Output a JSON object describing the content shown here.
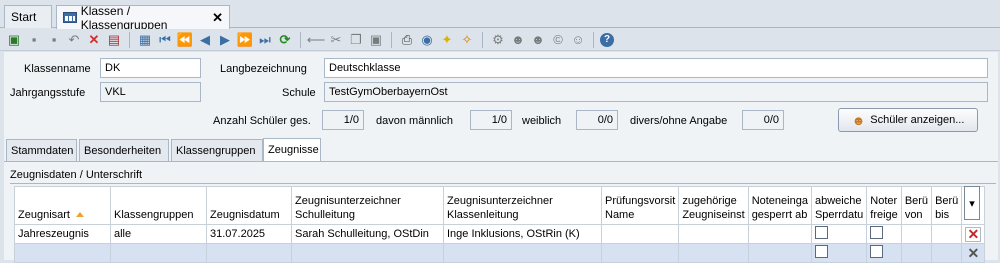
{
  "tabs": [
    {
      "label": "Start"
    },
    {
      "label": "Klassen / Klassengruppen"
    }
  ],
  "toolbar": {
    "icons": [
      "new-icon",
      "save-icon",
      "save-disabled-icon",
      "undo-icon",
      "delete-icon",
      "delete-record-icon",
      "list-icon",
      "first-icon",
      "prev-page-icon",
      "prev-icon",
      "next-icon",
      "next-page-icon",
      "last-icon",
      "refresh-icon",
      "back-arrow-icon",
      "cut-icon",
      "copy-icon",
      "paste-icon",
      "print-icon",
      "preview-icon",
      "bulb-icon",
      "wizard-icon",
      "settings-icon",
      "users-icon",
      "users2-icon",
      "copyright-icon",
      "user-settings-icon",
      "help-icon"
    ]
  },
  "form": {
    "klassenname_label": "Klassenname",
    "klassenname_value": "DK",
    "langbez_label": "Langbezeichnung",
    "langbez_value": "Deutschklasse",
    "jahrgang_label": "Jahrgangsstufe",
    "jahrgang_value": "VKL",
    "schule_label": "Schule",
    "schule_value": "TestGymOberbayernOst",
    "anzahl_label": "Anzahl Schüler ges.",
    "anzahl_value": "1/0",
    "maennlich_label": "davon männlich",
    "maennlich_value": "1/0",
    "weiblich_label": "weiblich",
    "weiblich_value": "0/0",
    "divers_label": "divers/ohne Angabe",
    "divers_value": "0/0",
    "show_button": "Schüler anzeigen..."
  },
  "pagetabs": [
    "Stammdaten",
    "Besonderheiten",
    "Klassengruppen",
    "Zeugnisse"
  ],
  "group_title": "Zeugnisdaten / Unterschrift",
  "table": {
    "headers": [
      [
        "Zeugnisart",
        ""
      ],
      [
        "Klassengruppen",
        ""
      ],
      [
        "Zeugnisdatum",
        ""
      ],
      [
        "Zeugnisunterzeichner",
        "Schulleitung"
      ],
      [
        "Zeugnisunterzeichner",
        "Klassenleitung"
      ],
      [
        "Prüfungsvorsit",
        "Name"
      ],
      [
        "zugehörige",
        "Zeugniseinst"
      ],
      [
        "Noteneinga",
        "gesperrt ab"
      ],
      [
        "abweiche",
        "Sperrdatu"
      ],
      [
        "Noter",
        "freige"
      ],
      [
        "Berü",
        "von"
      ],
      [
        "Berü",
        "bis"
      ]
    ],
    "rows": [
      {
        "zeugnisart": "Jahreszeugnis",
        "gruppen": "alle",
        "datum": "31.07.2025",
        "schulleitung": "Sarah Schulleitung, OStDin",
        "klassenleitung": "Inge Inklusions, OStRin (K)",
        "pruefung": "",
        "zugehoerig": "",
        "gesperrt": ""
      }
    ]
  }
}
